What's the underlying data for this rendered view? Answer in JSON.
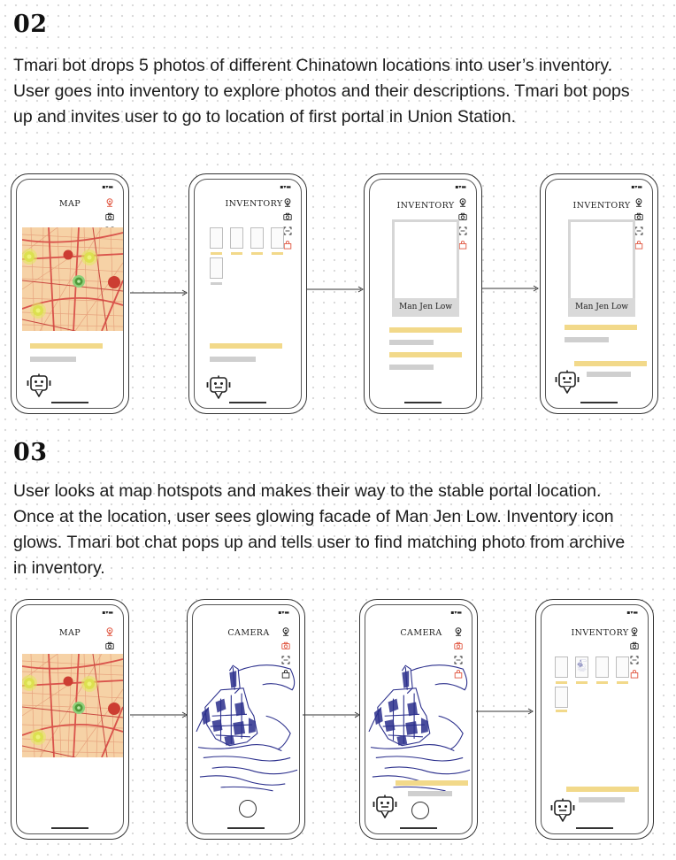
{
  "sections": [
    {
      "number": "02",
      "description_lines": [
        "Tmari bot drops 5 photos of different Chinatown locations into user’s inventory.",
        "User goes into inventory to explore photos and their descriptions. Tmari bot pops",
        "up and invites user to go to location of first portal in Union Station."
      ],
      "screens": [
        {
          "title": "MAP"
        },
        {
          "title": "INVENTORY"
        },
        {
          "title": "INVENTORY",
          "photo_label": "Man Jen Low"
        },
        {
          "title": "INVENTORY",
          "photo_label": "Man Jen Low"
        }
      ]
    },
    {
      "number": "03",
      "description_lines": [
        "User looks at map hotspots and makes their way to the stable portal location.",
        "Once at the location, user sees glowing facade of Man Jen Low.  Inventory icon",
        "glows. Tmari bot chat pops up and tells user to find matching photo from archive",
        "in inventory."
      ],
      "screens": [
        {
          "title": "MAP"
        },
        {
          "title": "CAMERA"
        },
        {
          "title": "CAMERA"
        },
        {
          "title": "INVENTORY"
        }
      ]
    }
  ],
  "icons": [
    "map-pin-icon",
    "camera-icon",
    "scan-icon",
    "bag-icon",
    "bot-icon"
  ],
  "colors": {
    "highlight": "#f2d98a",
    "placeholder": "#cfcfcf",
    "active_icon": "#e0553f",
    "map_bg": "#f6d2a6",
    "map_road": "#d9534b",
    "sketch_ink": "#2b2f8c"
  }
}
